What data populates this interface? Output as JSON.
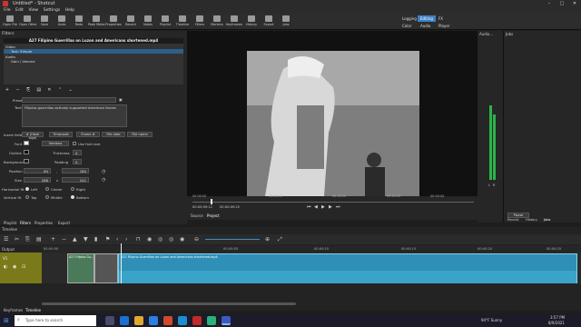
{
  "window": {
    "title": "Untitled* - Shotcut"
  },
  "menu": [
    "File",
    "Edit",
    "View",
    "Settings",
    "Help"
  ],
  "toolbar": [
    {
      "label": "Open File",
      "icon": "folder-icon"
    },
    {
      "label": "Open Other",
      "icon": "folder-plus-icon"
    },
    {
      "label": "Save",
      "icon": "save-icon"
    },
    {
      "label": "Undo",
      "icon": "undo-icon"
    },
    {
      "label": "Redo",
      "icon": "redo-icon"
    },
    {
      "label": "Peak Meter",
      "icon": "meter-icon"
    },
    {
      "label": "Properties",
      "icon": "info-icon"
    },
    {
      "label": "Recent",
      "icon": "recent-icon"
    },
    {
      "label": "Notes",
      "icon": "notes-icon"
    },
    {
      "label": "Playlist",
      "icon": "playlist-icon"
    },
    {
      "label": "Timeline",
      "icon": "timeline-icon"
    },
    {
      "label": "Filters",
      "icon": "filter-icon"
    },
    {
      "label": "Markers",
      "icon": "marker-icon"
    },
    {
      "label": "Keyframes",
      "icon": "keyframe-icon"
    },
    {
      "label": "History",
      "icon": "history-icon"
    },
    {
      "label": "Export",
      "icon": "export-icon"
    },
    {
      "label": "Jobs",
      "icon": "jobs-icon"
    }
  ],
  "layouts": {
    "row1": [
      "Logging",
      "Editing",
      "FX"
    ],
    "row2": [
      "Color",
      "Audio",
      "Player"
    ]
  },
  "filters": {
    "title": "Filters",
    "clip_name": "A27 Filipino Guerrillas on Luzon and Americans shortened.mp4",
    "sections": [
      "Video",
      "Audio"
    ],
    "items": [
      "Text: Simple",
      "Gain / Volume"
    ],
    "preset_label": "Preset",
    "text_label": "Text",
    "text_value": "Filipino guerrillas actively supported American forces",
    "insert_field_label": "Insert field",
    "field_buttons": [
      "# (Hash sign)",
      "Timecode",
      "Frame #",
      "File date",
      "File name"
    ],
    "font_label": "Font",
    "font_value": "Verdana",
    "use_font_size": "Use font size",
    "outline_label": "Outline",
    "thickness_label": "Thickness",
    "thickness_value": "0",
    "background_label": "Background",
    "padding_label": "Padding",
    "padding_value": "0",
    "position_label": "Position",
    "position_x": "80",
    "position_y": "180",
    "size_label": "Size",
    "size_w": "288",
    "size_h": "241",
    "hfit_label": "Horizontal fit",
    "hfit_options": [
      "Left",
      "Center",
      "Right"
    ],
    "vfit_label": "Vertical fit",
    "vfit_options": [
      "Top",
      "Middle",
      "Bottom"
    ]
  },
  "left_tabs": [
    "Playlist",
    "Filters",
    "Properties",
    "Export"
  ],
  "player": {
    "timecode_in": "00:00:09:12",
    "timecode_total": "00:00:09:25",
    "ruler": [
      "00:00:00",
      "00:00:10",
      "00:00:20",
      "00:00:30",
      "00:00:40"
    ],
    "tabs": [
      "Source",
      "Project"
    ]
  },
  "audio": {
    "title": "Audio...",
    "scale": [
      "0",
      "-5",
      "-10",
      "-15",
      "-20",
      "-25",
      "-30",
      "-35",
      "-40",
      "-50"
    ],
    "channels": [
      "L",
      "R"
    ]
  },
  "jobs": {
    "title": "Jobs",
    "pause": "Pause",
    "tabs": [
      "Recent",
      "History",
      "Jobs"
    ]
  },
  "timeline": {
    "title": "Timeline",
    "output_label": "Output",
    "track_name": "V1",
    "ruler": [
      "00:00:00",
      "00:00:05",
      "00:00:10",
      "00:00:15",
      "00:00:20",
      "00:00:25"
    ],
    "clip1": "A27 Filipino Gu...",
    "clip3": "A27 Filipino Guerrillas on Luzon and Americans shortened.mp4",
    "bottom_tabs": [
      "Keyframes",
      "Timeline"
    ]
  },
  "taskbar": {
    "search_placeholder": "Type here to search",
    "weather": "94°F Sunny",
    "time": "3:57 PM",
    "date": "8/9/2021"
  },
  "colors": {
    "clip_blue": "#2f8fb6",
    "meter_green": "#2bb34a",
    "accent": "#2c5f8a"
  }
}
